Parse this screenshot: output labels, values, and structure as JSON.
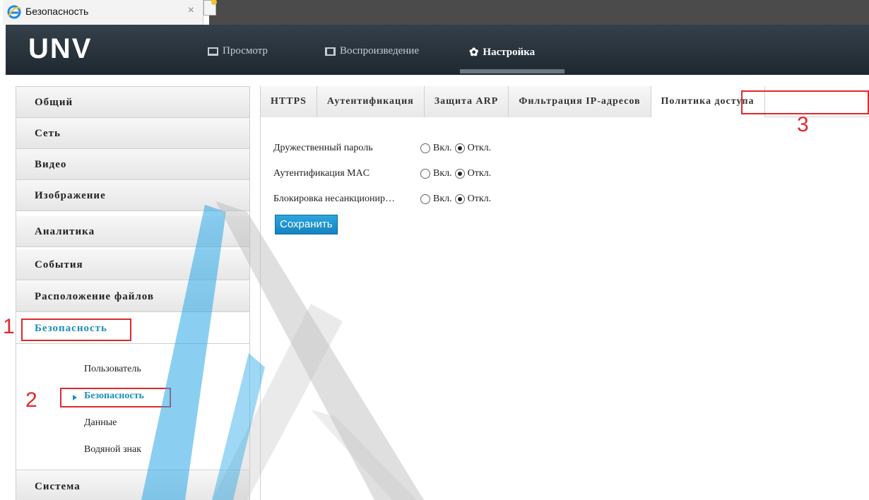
{
  "browser": {
    "tab_title": "Безопасность",
    "close_glyph": "×"
  },
  "header": {
    "logo": "UNV",
    "nav": [
      {
        "label": "Просмотр",
        "icon": "monitor-icon"
      },
      {
        "label": "Воспроизведение",
        "icon": "film-icon"
      },
      {
        "label": "Настройка",
        "icon": "gear-icon",
        "active": true
      }
    ]
  },
  "sidebar": {
    "items": [
      {
        "label": "Общий"
      },
      {
        "label": "Сеть"
      },
      {
        "label": "Видео"
      },
      {
        "label": "Изображение"
      },
      {
        "label": "Аналитика"
      },
      {
        "label": "События"
      },
      {
        "label": "Расположение файлов"
      },
      {
        "label": "Безопасность",
        "active": true
      },
      {
        "label": "Система"
      }
    ],
    "submenu": [
      {
        "label": "Пользователь"
      },
      {
        "label": "Безопасность",
        "active": true
      },
      {
        "label": "Данные"
      },
      {
        "label": "Водяной знак"
      }
    ]
  },
  "main": {
    "tabs": [
      {
        "label": "HTTPS"
      },
      {
        "label": "Аутентификация"
      },
      {
        "label": "Защита ARP"
      },
      {
        "label": "Фильтрация IP-адресов"
      },
      {
        "label": "Политика доступа",
        "active": true
      }
    ],
    "rows": [
      {
        "label": "Дружественный пароль",
        "on": "Вкл.",
        "off": "Откл.",
        "selected": "off"
      },
      {
        "label": "Аутентификация MAC",
        "on": "Вкл.",
        "off": "Откл.",
        "selected": "off"
      },
      {
        "label": "Блокировка несанкционир…",
        "on": "Вкл.",
        "off": "Откл.",
        "selected": "off"
      }
    ],
    "save_label": "Сохранить"
  },
  "annotations": [
    "1",
    "2",
    "3"
  ],
  "colors": {
    "accent": "#1a8fc0",
    "annotation": "#e0282e",
    "header": "#2b353e",
    "button": "#1e95d2"
  }
}
